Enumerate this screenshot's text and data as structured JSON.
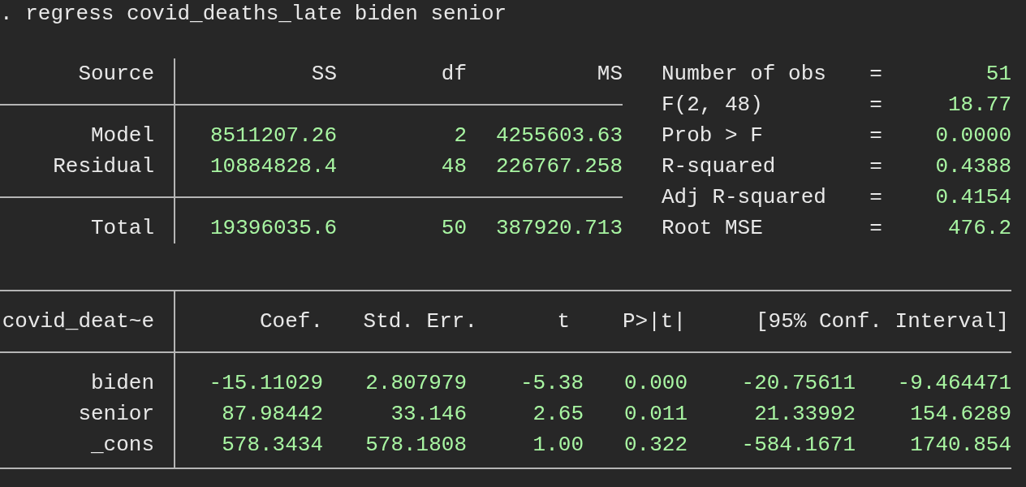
{
  "command": ". regress covid_deaths_late biden senior",
  "anova": {
    "columns": [
      "Source",
      "SS",
      "df",
      "MS"
    ],
    "rows": [
      {
        "source": "Model",
        "values": [
          "8511207.26",
          "2",
          "4255603.63"
        ]
      },
      {
        "source": "Residual",
        "values": [
          "10884828.4",
          "48",
          "226767.258"
        ]
      }
    ],
    "total": {
      "source": "Total",
      "values": [
        "19396035.6",
        "50",
        "387920.713"
      ]
    }
  },
  "stats": [
    {
      "label": "Number of obs",
      "sign": "=",
      "value": "51"
    },
    {
      "label": "F(2, 48)",
      "sign": "=",
      "value": "18.77"
    },
    {
      "label": "Prob > F",
      "sign": "=",
      "value": "0.0000"
    },
    {
      "label": "R-squared",
      "sign": "=",
      "value": "0.4388"
    },
    {
      "label": "Adj R-squared",
      "sign": "=",
      "value": "0.4154"
    },
    {
      "label": "Root MSE",
      "sign": "=",
      "value": "476.2"
    }
  ],
  "coefficients": {
    "dependent": "covid_deat~e",
    "columns": [
      "Coef.",
      "Std. Err.",
      "t",
      "P>|t|",
      "[95% Conf. Interval]"
    ],
    "rows": [
      {
        "name": "biden",
        "values": [
          "-15.11029",
          "2.807979",
          "-5.38",
          "0.000",
          "-20.75611",
          "-9.464471"
        ]
      },
      {
        "name": "senior",
        "values": [
          "87.98442",
          "33.146",
          "2.65",
          "0.011",
          "21.33992",
          "154.6289"
        ]
      },
      {
        "name": "_cons",
        "values": [
          "578.3434",
          "578.1808",
          "1.00",
          "0.322",
          "-584.1671",
          "1740.854"
        ]
      }
    ]
  }
}
